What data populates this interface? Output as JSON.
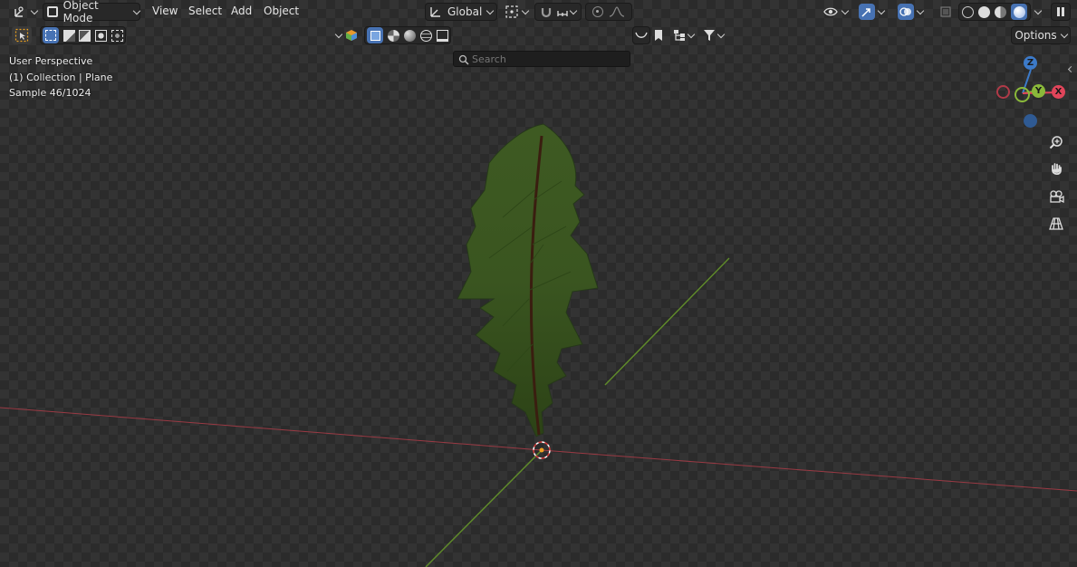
{
  "header": {
    "mode_label": "Object Mode",
    "menus": [
      "View",
      "Select",
      "Add",
      "Object"
    ],
    "transform_orientation": "Global",
    "options_label": "Options"
  },
  "search": {
    "placeholder": "Search"
  },
  "overlay": {
    "view_name": "User Perspective",
    "collection_info": "(1) Collection | Plane",
    "sample_info": "Sample 46/1024"
  },
  "gizmo": {
    "z_label": "Z",
    "y_label": "Y",
    "x_label": "X"
  },
  "colors": {
    "accent": "#4772b3",
    "x_axis": "#e0455a",
    "y_axis": "#8ab93a",
    "z_axis": "#3c7ac9"
  },
  "icons": {
    "editor_type": "axis-editor-icon",
    "navigate": [
      "zoom-icon",
      "hand-pan-icon",
      "camera-icon",
      "grid-perspective-icon"
    ]
  }
}
